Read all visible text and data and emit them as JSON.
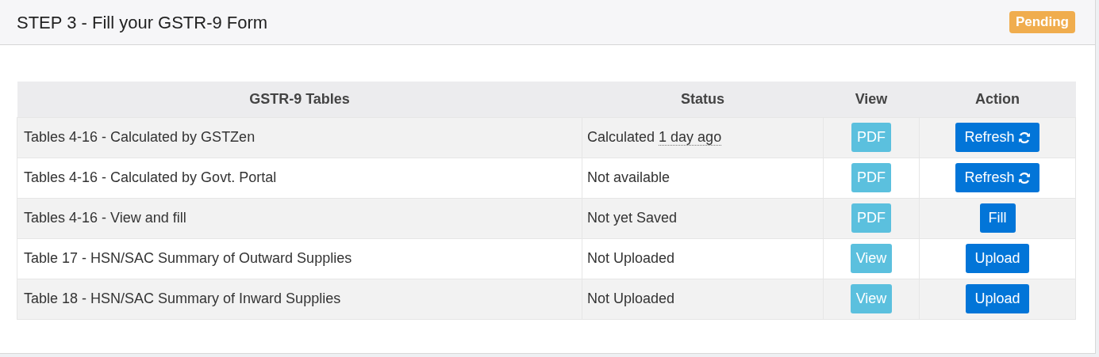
{
  "card": {
    "title": "STEP 3 - Fill your GSTR-9 Form",
    "badge": "Pending"
  },
  "table": {
    "columns": [
      "GSTR-9 Tables",
      "Status",
      "View",
      "Action"
    ],
    "rows": [
      {
        "name": "Tables 4-16 - Calculated by GSTZen",
        "status": "Calculated",
        "status_time": "1 day ago",
        "view": "PDF",
        "action": {
          "label": "Refresh",
          "kind": "refresh"
        }
      },
      {
        "name": "Tables 4-16 - Calculated by Govt. Portal",
        "status": "Not available",
        "view": "PDF",
        "action": {
          "label": "Refresh",
          "kind": "refresh"
        }
      },
      {
        "name": "Tables 4-16 - View and fill",
        "status": "Not yet Saved",
        "view": "PDF",
        "action": {
          "label": "Fill",
          "kind": "plain"
        }
      },
      {
        "name": "Table 17 - HSN/SAC Summary of Outward Supplies",
        "status": "Not Uploaded",
        "view": "View",
        "action": {
          "label": "Upload",
          "kind": "plain"
        }
      },
      {
        "name": "Table 18 - HSN/SAC Summary of Inward Supplies",
        "status": "Not Uploaded",
        "view": "View",
        "action": {
          "label": "Upload",
          "kind": "plain"
        }
      }
    ]
  }
}
